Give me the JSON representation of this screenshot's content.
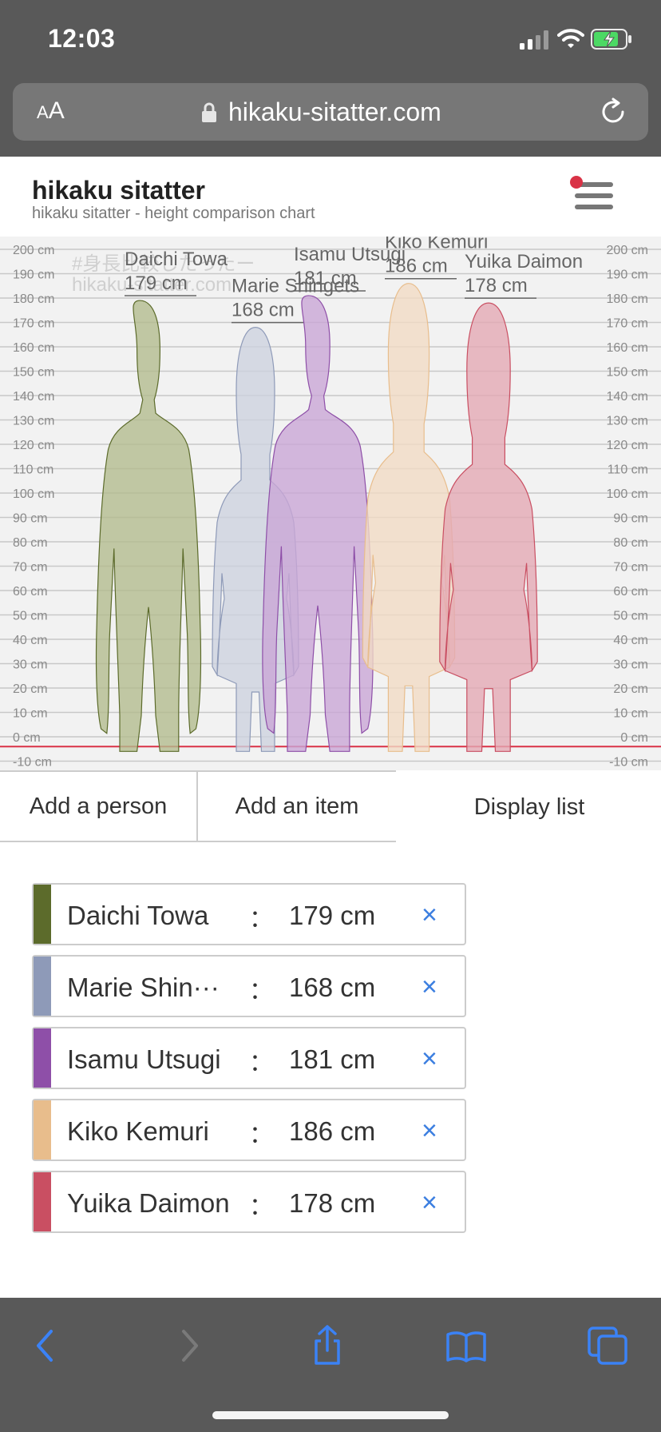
{
  "status_bar": {
    "time": "12:03"
  },
  "browser": {
    "text_size_label_small": "A",
    "text_size_label_large": "A",
    "url": "hikaku-sitatter.com"
  },
  "site": {
    "title": "hikaku sitatter",
    "subtitle": "hikaku sitatter - height comparison chart"
  },
  "chart": {
    "watermark_line1": "#身長比較したったー",
    "watermark_line2": "hikaku-sitatter.com",
    "unit": "cm",
    "y_min": -10,
    "y_max": 200,
    "y_step": 10,
    "ground_line_color": "#d93246"
  },
  "chart_data": {
    "type": "bar",
    "categories": [
      "Daichi Towa",
      "Marie Shingets",
      "Isamu Utsugi",
      "Kiko Kemuri",
      "Yuika Daimon"
    ],
    "values": [
      179,
      168,
      181,
      186,
      178
    ],
    "ylim": [
      -10,
      200
    ],
    "y_unit": "cm",
    "grid": true
  },
  "people": [
    {
      "chart_name": "Daichi Towa",
      "list_name": "Daichi Towa",
      "height": 179,
      "height_label": "179 cm",
      "color": "#5c6b2b",
      "fill": "#b3bc8f",
      "silhouette": "male"
    },
    {
      "chart_name": "Marie Shingets",
      "list_name": "Marie Shin···",
      "height": 168,
      "height_label": "168 cm",
      "color": "#8e9ab8",
      "fill": "#cdd2df",
      "silhouette": "female"
    },
    {
      "chart_name": "Isamu Utsugi",
      "list_name": "Isamu Utsugi",
      "height": 181,
      "height_label": "181 cm",
      "color": "#8e4fa8",
      "fill": "#c9a6d6",
      "silhouette": "male"
    },
    {
      "chart_name": "Kiko Kemuri",
      "list_name": "Kiko Kemuri",
      "height": 186,
      "height_label": "186 cm",
      "color": "#e8bd8c",
      "fill": "#f1dbc4",
      "silhouette": "female"
    },
    {
      "chart_name": "Yuika Daimon",
      "list_name": "Yuika Daimon",
      "height": 178,
      "height_label": "178 cm",
      "color": "#c94f62",
      "fill": "#e4a9b4",
      "silhouette": "female"
    }
  ],
  "list": {
    "separator": "：",
    "remove_symbol": "×"
  },
  "actions": {
    "add_person": "Add a person",
    "add_item": "Add an item",
    "display_list": "Display list"
  }
}
